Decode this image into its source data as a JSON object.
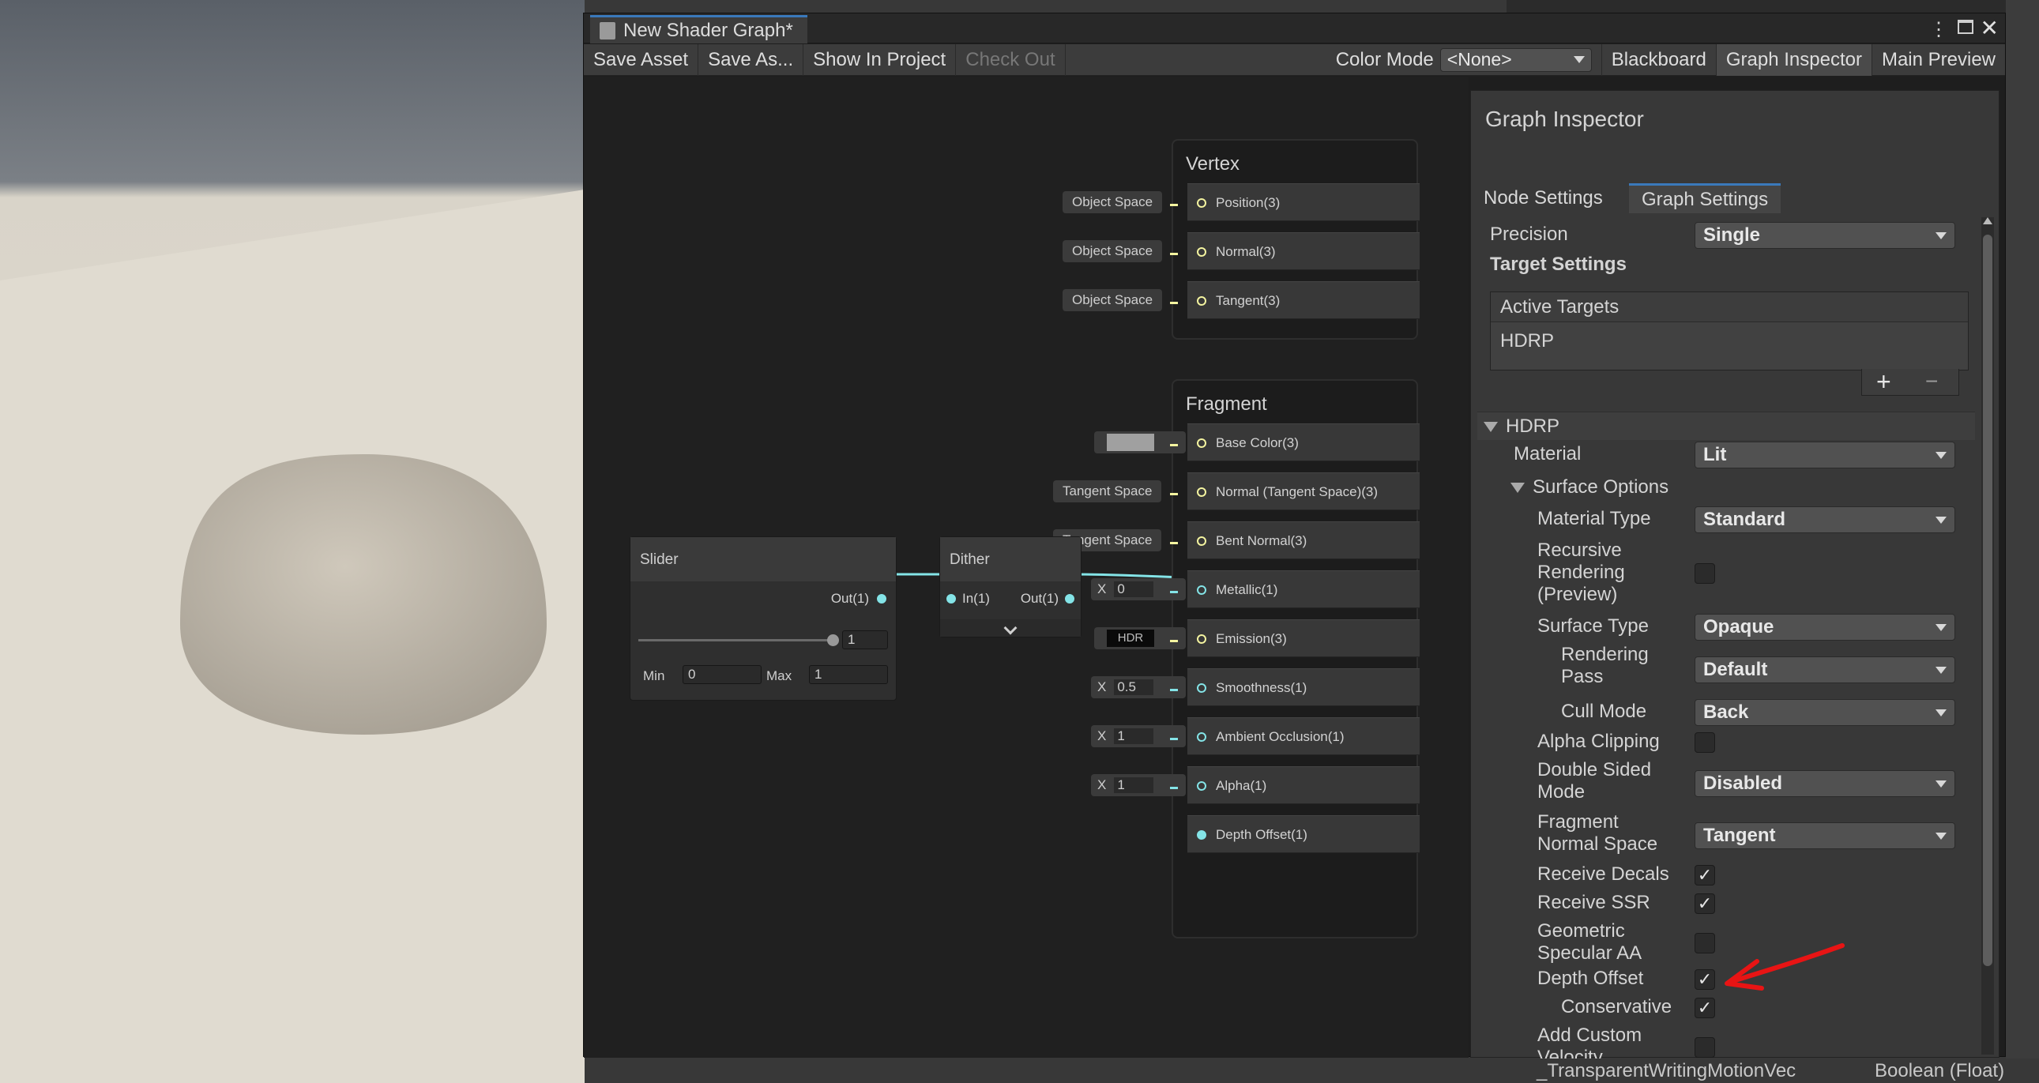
{
  "window": {
    "title": "New Shader Graph*"
  },
  "toolbar": {
    "save_asset": "Save Asset",
    "save_as": "Save As...",
    "show_in_project": "Show In Project",
    "check_out": "Check Out",
    "color_mode_label": "Color Mode",
    "color_mode_value": "<None>",
    "blackboard": "Blackboard",
    "graph_inspector": "Graph Inspector",
    "main_preview": "Main Preview"
  },
  "graph": {
    "vertex": {
      "title": "Vertex",
      "ports": [
        {
          "label": "Position(3)",
          "inline": "Object Space"
        },
        {
          "label": "Normal(3)",
          "inline": "Object Space"
        },
        {
          "label": "Tangent(3)",
          "inline": "Object Space"
        }
      ]
    },
    "fragment": {
      "title": "Fragment",
      "ports": [
        {
          "label": "Base Color(3)",
          "inline": ""
        },
        {
          "label": "Normal (Tangent Space)(3)",
          "inline": "Tangent Space"
        },
        {
          "label": "Bent Normal(3)",
          "inline": "Tangent Space"
        },
        {
          "label": "Metallic(1)",
          "x": "X",
          "value": "0"
        },
        {
          "label": "Emission(3)",
          "inline": "HDR"
        },
        {
          "label": "Smoothness(1)",
          "x": "X",
          "value": "0.5"
        },
        {
          "label": "Ambient Occlusion(1)",
          "x": "X",
          "value": "1"
        },
        {
          "label": "Alpha(1)",
          "x": "X",
          "value": "1"
        },
        {
          "label": "Depth Offset(1)"
        }
      ]
    },
    "slider": {
      "title": "Slider",
      "out": "Out(1)",
      "value": "1",
      "min_label": "Min",
      "min": "0",
      "max_label": "Max",
      "max": "1"
    },
    "dither": {
      "title": "Dither",
      "in": "In(1)",
      "out": "Out(1)"
    }
  },
  "inspector": {
    "title": "Graph Inspector",
    "tabs": [
      "Node Settings",
      "Graph Settings"
    ],
    "precision_label": "Precision",
    "precision_value": "Single",
    "target_settings": "Target Settings",
    "active_targets": "Active Targets",
    "target_item": "HDRP",
    "hdrp_section": "HDRP",
    "material_label": "Material",
    "material_value": "Lit",
    "surface_options": "Surface Options",
    "material_type_label": "Material Type",
    "material_type_value": "Standard",
    "recursive_label_1": "Recursive",
    "recursive_label_2": "Rendering",
    "recursive_label_3": "(Preview)",
    "surface_type_label": "Surface Type",
    "surface_type_value": "Opaque",
    "rendering_pass_label_1": "Rendering",
    "rendering_pass_label_2": "Pass",
    "rendering_pass_value": "Default",
    "cull_mode_label": "Cull Mode",
    "cull_mode_value": "Back",
    "alpha_clipping_label": "Alpha Clipping",
    "double_sided_label_1": "Double Sided",
    "double_sided_label_2": "Mode",
    "double_sided_value": "Disabled",
    "fragment_normal_label_1": "Fragment",
    "fragment_normal_label_2": "Normal Space",
    "fragment_normal_value": "Tangent",
    "receive_decals_label": "Receive Decals",
    "receive_ssr_label": "Receive SSR",
    "geometric_label_1": "Geometric",
    "geometric_label_2": "Specular AA",
    "depth_offset_label": "Depth Offset",
    "conservative_label": "Conservative",
    "add_custom_label_1": "Add Custom",
    "add_custom_label_2": "Velocity",
    "checkmark": "✓"
  },
  "status": {
    "left": "_TransparentWritingMotionVec",
    "right": "Boolean (Float)"
  },
  "colors": {
    "accent": "#3a79bb",
    "annotation": "#e81414",
    "vec3_port": "#f4f4a0",
    "float_port": "#84e4e7"
  }
}
